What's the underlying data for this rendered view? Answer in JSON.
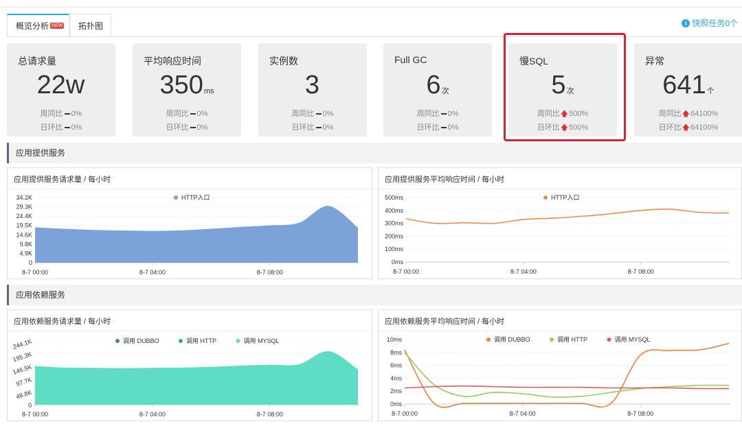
{
  "tabs": [
    {
      "label": "概览分析",
      "badge": "NEW"
    },
    {
      "label": "拓扑图"
    }
  ],
  "snapshot_label": "快照任务0个",
  "cards": [
    {
      "title": "总请求量",
      "value": "22w",
      "unit": "",
      "wow_label": "周同比",
      "wow_dir": "flat",
      "wow_value": "0%",
      "dod_label": "日环比",
      "dod_dir": "flat",
      "dod_value": "0%"
    },
    {
      "title": "平均响应时间",
      "value": "350",
      "unit": "ms",
      "wow_label": "周同比",
      "wow_dir": "flat",
      "wow_value": "0%",
      "dod_label": "日环比",
      "dod_dir": "flat",
      "dod_value": "0%"
    },
    {
      "title": "实例数",
      "value": "3",
      "unit": "",
      "wow_label": "周同比",
      "wow_dir": "flat",
      "wow_value": "0%",
      "dod_label": "日环比",
      "dod_dir": "flat",
      "dod_value": "0%"
    },
    {
      "title": "Full GC",
      "value": "6",
      "unit": "次",
      "wow_label": "周同比",
      "wow_dir": "flat",
      "wow_value": "0%",
      "dod_label": "日环比",
      "dod_dir": "flat",
      "dod_value": "0%"
    },
    {
      "title": "慢SQL",
      "value": "5",
      "unit": "次",
      "wow_label": "周同比",
      "wow_dir": "up",
      "wow_value": "500%",
      "dod_label": "日环比",
      "dod_dir": "up",
      "dod_value": "500%"
    },
    {
      "title": "异常",
      "value": "641",
      "unit": "个",
      "wow_label": "周同比",
      "wow_dir": "up",
      "wow_value": "64100%",
      "dod_label": "日环比",
      "dod_dir": "up",
      "dod_value": "64100%"
    }
  ],
  "sections": [
    "应用提供服务",
    "应用依赖服务"
  ],
  "colors": {
    "accent": "#2aa7e0",
    "up": "#e52d2d",
    "highlight": "#d9202c"
  },
  "chart_data": [
    {
      "type": "area",
      "title": "应用提供服务请求量 / 每小时",
      "x": [
        "8-7 00:00",
        "8-7 01:00",
        "8-7 02:00",
        "8-7 03:00",
        "8-7 04:00",
        "8-7 05:00",
        "8-7 06:00",
        "8-7 07:00",
        "8-7 08:00",
        "8-7 09:00",
        "8-7 10:00",
        "8-7 11:00"
      ],
      "xticks": [
        "8-7 00:00",
        "8-7 04:00",
        "8-7 08:00"
      ],
      "yticks": [
        "0",
        "4.9K",
        "9.8K",
        "14.6K",
        "19.5K",
        "24.4K",
        "29.3K",
        "34.2K"
      ],
      "ylim": [
        0,
        34200
      ],
      "series": [
        {
          "name": "HTTP入口",
          "color": "#7ba3d9",
          "values": [
            18600,
            17800,
            17200,
            16900,
            16700,
            17000,
            17800,
            18800,
            19600,
            21000,
            29800,
            18400
          ]
        }
      ]
    },
    {
      "type": "line",
      "title": "应用提供服务平均响应时间 / 每小时",
      "x": [
        "8-7 00:00",
        "8-7 01:00",
        "8-7 02:00",
        "8-7 03:00",
        "8-7 04:00",
        "8-7 05:00",
        "8-7 06:00",
        "8-7 07:00",
        "8-7 08:00",
        "8-7 09:00",
        "8-7 10:00",
        "8-7 11:00"
      ],
      "xticks": [
        "8-7 00:00",
        "8-7 04:00",
        "8-7 08:00"
      ],
      "yticks": [
        "0ms",
        "100ms",
        "200ms",
        "300ms",
        "400ms",
        "500ms"
      ],
      "ylim": [
        0,
        500
      ],
      "series": [
        {
          "name": "HTTP入口",
          "color": "#f08c4a",
          "values": [
            335,
            300,
            305,
            300,
            330,
            340,
            355,
            375,
            400,
            410,
            385,
            380
          ]
        }
      ]
    },
    {
      "type": "area",
      "title": "应用依赖服务请求量 / 每小时",
      "x": [
        "8-7 00:00",
        "8-7 01:00",
        "8-7 02:00",
        "8-7 03:00",
        "8-7 04:00",
        "8-7 05:00",
        "8-7 06:00",
        "8-7 07:00",
        "8-7 08:00",
        "8-7 09:00",
        "8-7 10:00",
        "8-7 11:00"
      ],
      "xticks": [
        "8-7 00:00",
        "8-7 04:00",
        "8-7 08:00"
      ],
      "yticks": [
        "0",
        "48.8K",
        "97.7K",
        "146.5K",
        "195.3K",
        "244.1K"
      ],
      "ylim": [
        0,
        244100
      ],
      "series": [
        {
          "name": "调用 DUBBO",
          "color": "#4a7eb5",
          "values": [
            0,
            0,
            0,
            0,
            0,
            0,
            0,
            0,
            0,
            0,
            0,
            0
          ]
        },
        {
          "name": "调用 HTTP",
          "color": "#1fb2a3",
          "values": [
            0,
            0,
            0,
            0,
            0,
            0,
            0,
            0,
            0,
            0,
            0,
            0
          ]
        },
        {
          "name": "调用 MYSQL",
          "color": "#5fdcc4",
          "values": [
            148000,
            142000,
            141000,
            140000,
            141000,
            142000,
            145000,
            150000,
            153000,
            155000,
            205000,
            135000
          ]
        }
      ]
    },
    {
      "type": "line",
      "title": "应用依赖服务平均响应时间 / 每小时",
      "x": [
        "8-7 00:00",
        "8-7 01:00",
        "8-7 02:00",
        "8-7 03:00",
        "8-7 04:00",
        "8-7 05:00",
        "8-7 06:00",
        "8-7 07:00",
        "8-7 08:00",
        "8-7 09:00",
        "8-7 10:00",
        "8-7 11:00"
      ],
      "xticks": [
        "8-7 00:00",
        "8-7 04:00",
        "8-7 08:00"
      ],
      "yticks": [
        "0ms",
        "2ms",
        "4ms",
        "6ms",
        "8ms",
        "10ms"
      ],
      "ylim": [
        0,
        10
      ],
      "series": [
        {
          "name": "调用 DUBBO",
          "color": "#f07f3c",
          "values": [
            8.4,
            0.1,
            0.1,
            0.1,
            0.1,
            0.1,
            0.1,
            0.1,
            7.6,
            8.3,
            8.4,
            9.4
          ]
        },
        {
          "name": "调用 HTTP",
          "color": "#93d055",
          "values": [
            8.0,
            3.0,
            1.2,
            1.8,
            1.6,
            1.1,
            1.2,
            1.8,
            2.4,
            2.7,
            2.9,
            2.9
          ]
        },
        {
          "name": "调用 MYSQL",
          "color": "#e95661",
          "values": [
            2.5,
            2.7,
            2.8,
            2.7,
            2.6,
            2.6,
            2.6,
            2.5,
            2.5,
            2.5,
            2.4,
            2.4
          ]
        }
      ]
    }
  ]
}
